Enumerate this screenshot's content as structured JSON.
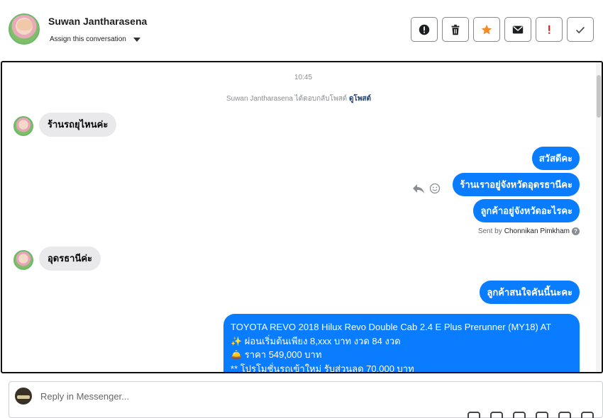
{
  "header": {
    "contact_name": "Suwan Jantharasena",
    "assign_label": "Assign this conversation",
    "toolbar": [
      {
        "name": "report-button",
        "icon": "alert-circle-icon"
      },
      {
        "name": "delete-button",
        "icon": "trash-icon"
      },
      {
        "name": "star-button",
        "icon": "star-icon"
      },
      {
        "name": "mark-unread-button",
        "icon": "envelope-icon"
      },
      {
        "name": "important-button",
        "icon": "exclamation-icon"
      },
      {
        "name": "done-button",
        "icon": "checkmark-icon"
      }
    ]
  },
  "chat": {
    "time": "10:45",
    "replied_notice": "Suwan Jantharasena ได้ตอบกลับโพสต์",
    "view_post": "ดูโพสต์",
    "messages": {
      "in1": "ร้านรถยุไหนค่ะ",
      "out1": "สวัสดีคะ",
      "out2": "ร้านเราอยู่จังหวัดอุดรธานีคะ",
      "out3": "ลูกค้าอยู่จังหวัดอะไรคะ",
      "in2": "อุดรธานีค่ะ",
      "out4": "ลูกค้าสนใจคันนี้นะคะ",
      "long": [
        "TOYOTA REVO 2018 Hilux Revo Double Cab 2.4 E Plus Prerunner (MY18) AT",
        "✨  ผ่อนเริ่มต้นเพียง 8,xxx บาท งวด 84 งวด",
        "🛎️  ราคา 549,000 บาท",
        "** โปรโมชั่นรถเข้าใหม่ รับส่วนลด 70,000 บาท"
      ]
    },
    "sent_by_prefix": "Sent by",
    "sent_by_name": "Chonnikan Pimkham"
  },
  "composer": {
    "placeholder": "Reply in Messenger..."
  },
  "colors": {
    "outgoing_bubble": "#0a7cff",
    "incoming_bubble": "#e9e9eb",
    "star": "#f28c28",
    "important": "#e02020"
  }
}
